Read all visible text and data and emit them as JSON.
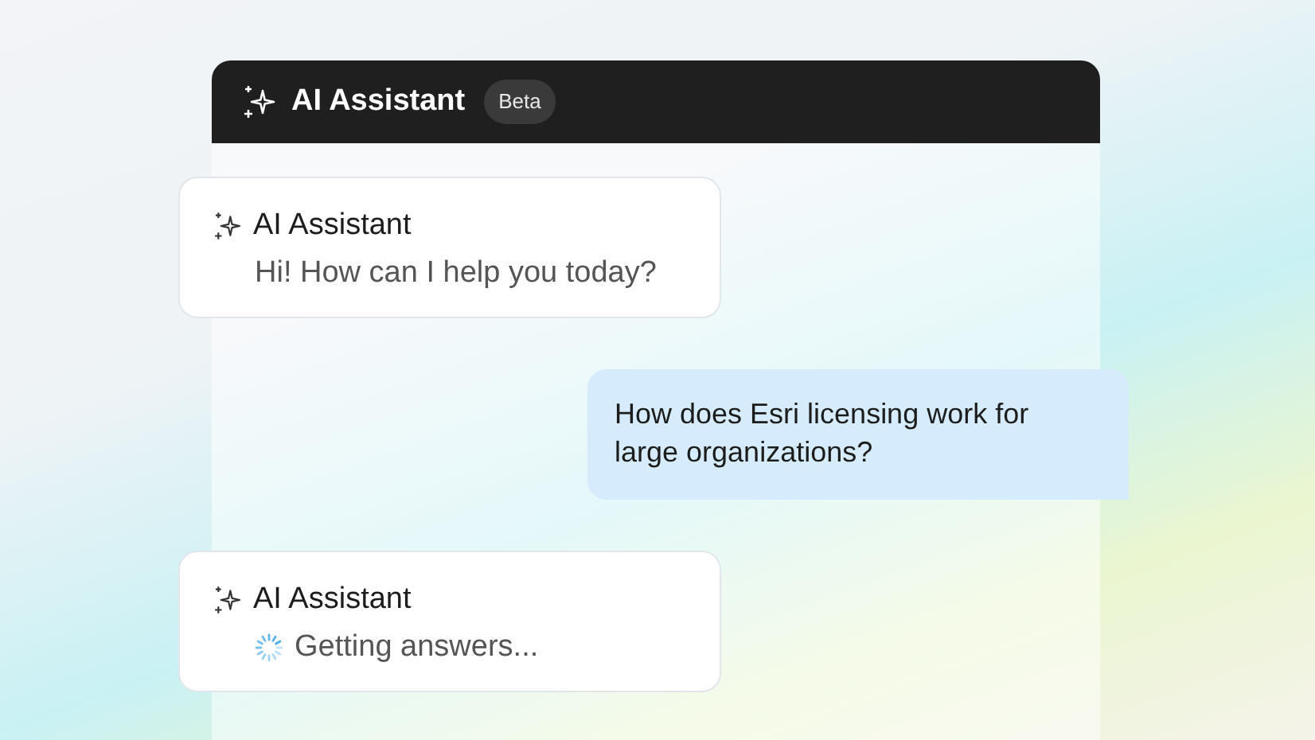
{
  "header": {
    "title": "AI Assistant",
    "badge": "Beta"
  },
  "messages": [
    {
      "kind": "assistant",
      "sender": "AI Assistant",
      "text": "Hi! How can I help you today?"
    },
    {
      "kind": "user",
      "text": "How does Esri licensing work for large organizations?"
    },
    {
      "kind": "loading",
      "sender": "AI Assistant",
      "text": "Getting answers..."
    }
  ]
}
